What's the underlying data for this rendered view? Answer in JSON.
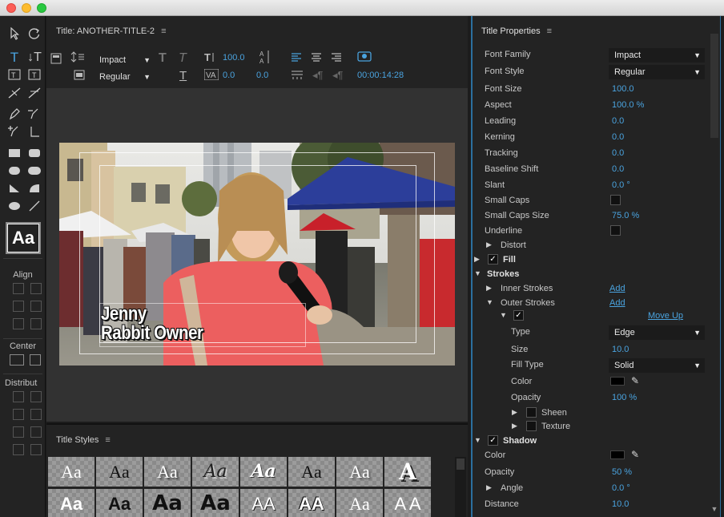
{
  "window": {
    "controls": [
      "close",
      "minimize",
      "zoom"
    ]
  },
  "editor": {
    "title_label": "Title: ANOTHER-TITLE-2",
    "font_family": "Impact",
    "font_style": "Regular",
    "font_size": "100.0",
    "leading": "0.0",
    "kerning": "0.0",
    "timecode": "00:00:14:28"
  },
  "tools": {
    "align_label": "Align",
    "center_label": "Center",
    "distribute_label": "Distribut",
    "style_preview": "Aa"
  },
  "caption": {
    "line1": "Jenny",
    "line2": "Rabbit Owner"
  },
  "title_styles": {
    "label": "Title Styles",
    "tiles": [
      "Aa",
      "Aa",
      "Aa",
      "Aa",
      "Aa",
      "Aa",
      "Aa",
      "A",
      "Aa",
      "Aa",
      "Aa",
      "Aa",
      "AA",
      "AA",
      "Aa",
      "A A"
    ]
  },
  "properties": {
    "label": "Title Properties",
    "rows": {
      "font_family": {
        "label": "Font Family",
        "value": "Impact"
      },
      "font_style": {
        "label": "Font Style",
        "value": "Regular"
      },
      "font_size": {
        "label": "Font Size",
        "value": "100.0"
      },
      "aspect": {
        "label": "Aspect",
        "value": "100.0 %"
      },
      "leading": {
        "label": "Leading",
        "value": "0.0"
      },
      "kerning": {
        "label": "Kerning",
        "value": "0.0"
      },
      "tracking": {
        "label": "Tracking",
        "value": "0.0"
      },
      "baseline_shift": {
        "label": "Baseline Shift",
        "value": "0.0"
      },
      "slant": {
        "label": "Slant",
        "value": "0.0 °"
      },
      "small_caps": {
        "label": "Small Caps"
      },
      "small_caps_size": {
        "label": "Small Caps Size",
        "value": "75.0 %"
      },
      "underline": {
        "label": "Underline"
      },
      "distort": {
        "label": "Distort"
      },
      "fill": {
        "label": "Fill"
      },
      "strokes": {
        "label": "Strokes"
      },
      "inner_strokes": {
        "label": "Inner Strokes",
        "action": "Add"
      },
      "outer_strokes": {
        "label": "Outer Strokes",
        "action": "Add"
      },
      "stroke_item": {
        "action": "Move Up"
      },
      "type": {
        "label": "Type",
        "value": "Edge"
      },
      "size": {
        "label": "Size",
        "value": "10.0"
      },
      "fill_type": {
        "label": "Fill Type",
        "value": "Solid"
      },
      "color": {
        "label": "Color"
      },
      "opacity": {
        "label": "Opacity",
        "value": "100 %"
      },
      "sheen": {
        "label": "Sheen"
      },
      "texture": {
        "label": "Texture"
      },
      "shadow": {
        "label": "Shadow"
      },
      "shadow_color": {
        "label": "Color"
      },
      "shadow_opacity": {
        "label": "Opacity",
        "value": "50 %"
      },
      "angle": {
        "label": "Angle",
        "value": "0.0 °"
      },
      "distance": {
        "label": "Distance",
        "value": "10.0"
      }
    }
  },
  "colors": {
    "accent": "#4aa3df",
    "panel": "#232323",
    "canvas": "#323232",
    "stroke_color": "#000000",
    "shadow_color": "#000000"
  }
}
